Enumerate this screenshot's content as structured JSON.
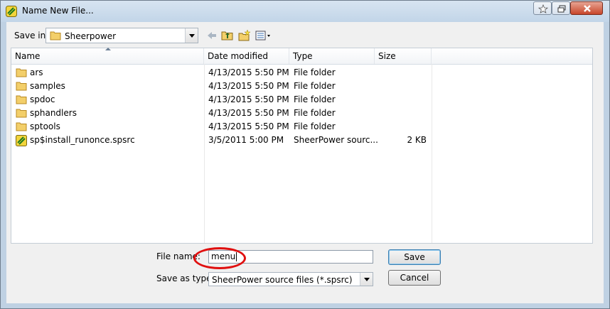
{
  "window": {
    "title": "Name New File..."
  },
  "toolbar": {
    "save_in_label": "Save in:",
    "save_in_value": "Sheerpower"
  },
  "columns": [
    "Name",
    "Date modified",
    "Type",
    "Size"
  ],
  "files": [
    {
      "name": "ars",
      "date": "4/13/2015 5:50 PM",
      "type": "File folder",
      "size": "",
      "icon": "folder-icon"
    },
    {
      "name": "samples",
      "date": "4/13/2015 5:50 PM",
      "type": "File folder",
      "size": "",
      "icon": "folder-icon"
    },
    {
      "name": "spdoc",
      "date": "4/13/2015 5:50 PM",
      "type": "File folder",
      "size": "",
      "icon": "folder-icon"
    },
    {
      "name": "sphandlers",
      "date": "4/13/2015 5:50 PM",
      "type": "File folder",
      "size": "",
      "icon": "folder-icon"
    },
    {
      "name": "sptools",
      "date": "4/13/2015 5:50 PM",
      "type": "File folder",
      "size": "",
      "icon": "folder-icon"
    },
    {
      "name": "sp$install_runonce.spsrc",
      "date": "3/5/2011 5:00 PM",
      "type": "SheerPower sourc...",
      "size": "2 KB",
      "icon": "sheerpower-file-icon"
    }
  ],
  "footer": {
    "file_name_label": "File name:",
    "file_name_value": "menu",
    "save_as_type_label": "Save as type:",
    "save_as_type_value": "SheerPower source files (*.spsrc)",
    "save_button": "Save",
    "cancel_button": "Cancel"
  },
  "colors": {
    "highlight": "#e01010",
    "title_bar": "#c2d5e8",
    "close_button": "#c7462a"
  }
}
